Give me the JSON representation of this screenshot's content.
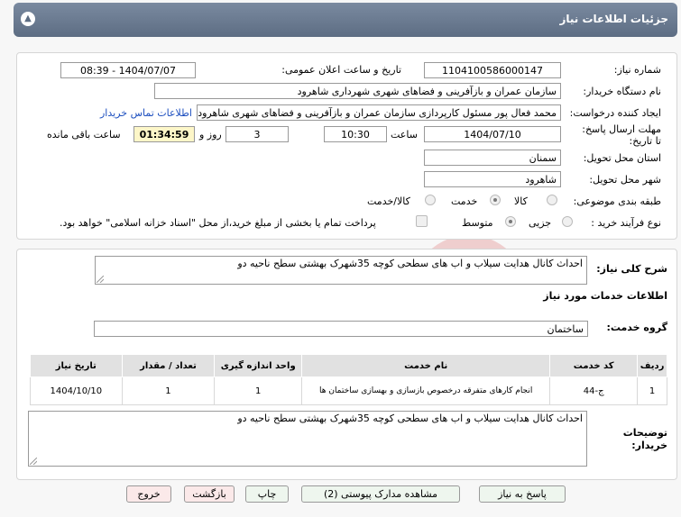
{
  "header": {
    "title": "جزئیات اطلاعات نیاز"
  },
  "form": {
    "need_number_label": "شماره نیاز:",
    "need_number": "1104100586000147",
    "announce_label": "تاریخ و ساعت اعلان عمومی:",
    "announce_value": "1404/07/07 - 08:39",
    "buyer_org_label": "نام دستگاه خریدار:",
    "buyer_org": "سازمان عمران و بازآفرینی و فضاهای شهری شهرداری شاهرود",
    "creator_label": "ایجاد کننده درخواست:",
    "creator": "محمد فعال پور مسئول کارپردازی سازمان عمران و بازآفرینی و فضاهای شهری شاهرود",
    "contact_link": "اطلاعات تماس خریدار",
    "deadline_label": "مهلت ارسال پاسخ: تا تاریخ:",
    "deadline_date": "1404/07/10",
    "time_label": "ساعت",
    "deadline_time": "10:30",
    "days_value": "3",
    "days_label": "روز و",
    "remaining_time": "01:34:59",
    "remaining_label": "ساعت باقی مانده",
    "province_label": "استان محل تحویل:",
    "province": "سمنان",
    "city_label": "شهر محل تحویل:",
    "city": "شاهرود",
    "category_label": "طبقه بندی موضوعی:",
    "category_options": [
      "کالا",
      "خدمت",
      "کالا/خدمت"
    ],
    "process_label": "نوع فرآیند خرید :",
    "process_options": [
      "جزیی",
      "متوسط"
    ],
    "payment_note": "پرداخت تمام یا بخشی از مبلغ خرید،از محل \"اسناد خزانه اسلامی\" خواهد بود."
  },
  "summary": {
    "label": "شرح کلی نیاز:",
    "text": "احداث کانال هدایت سیلاب و اب های سطحی کوچه 35شهرک بهشتی سطح ناحیه دو"
  },
  "services": {
    "section_title": "اطلاعات خدمات مورد نیاز",
    "group_label": "گروه خدمت:",
    "group_value": "ساختمان",
    "columns": [
      "ردیف",
      "کد خدمت",
      "نام خدمت",
      "واحد اندازه گیری",
      "تعداد / مقدار",
      "تاریخ نیاز"
    ],
    "rows": [
      [
        "1",
        "ج-44",
        "انجام کارهای متفرقه درخصوص بازسازی و بهسازی ساختمان ها",
        "1",
        "1",
        "1404/10/10"
      ]
    ]
  },
  "buyer_notes": {
    "label": "توضیحات خریدار:",
    "text": "احداث کانال هدایت سیلاب و اب های سطحی کوچه 35شهرک بهشتی سطح ناحیه دو"
  },
  "buttons": {
    "reply": "پاسخ به نیاز",
    "attachments": "مشاهده مدارک پیوستی (2)",
    "print": "چاپ",
    "back": "بازگشت",
    "exit": "خروج"
  },
  "colors": {
    "header": "#6b7b91",
    "link": "#1d4fbf",
    "timer_bg": "#fdf6c8"
  }
}
